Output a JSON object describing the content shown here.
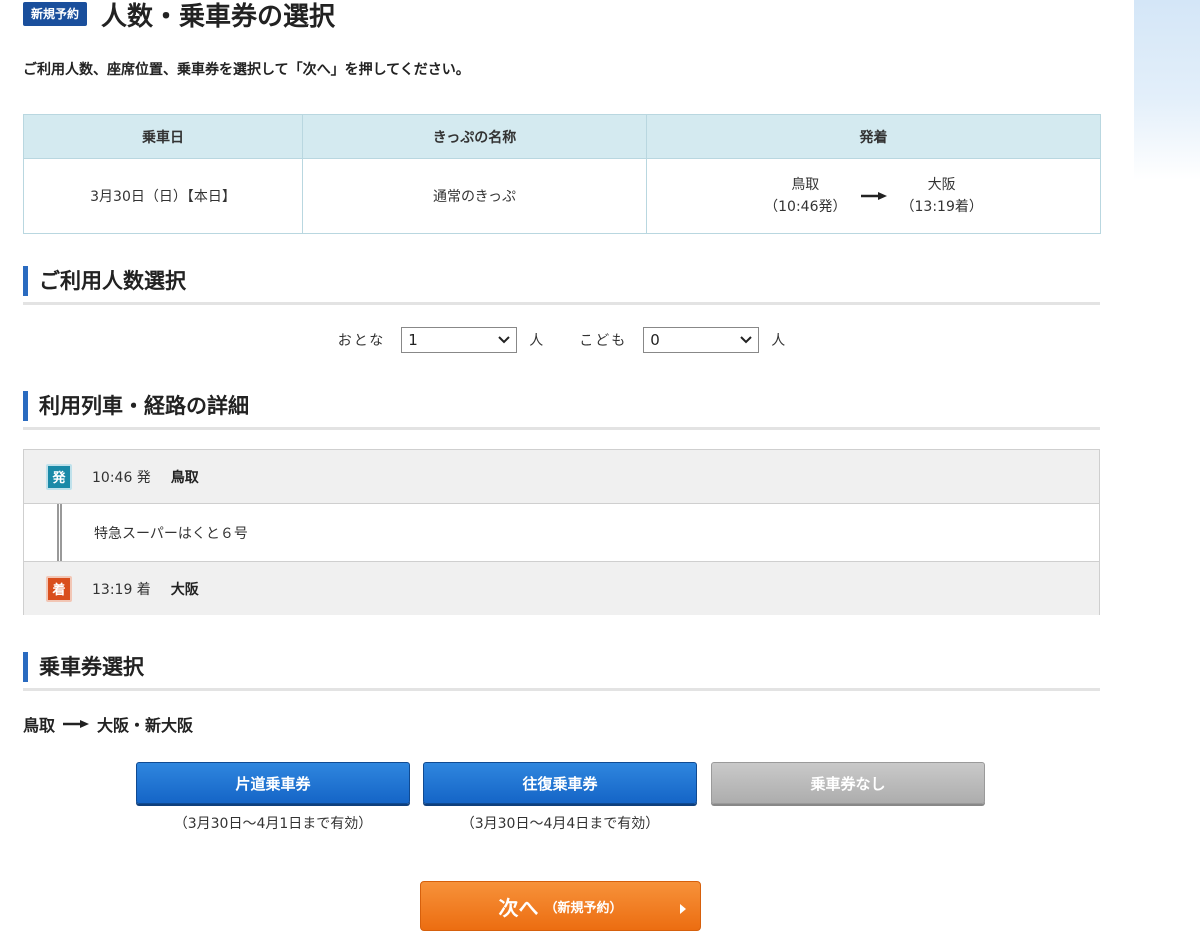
{
  "header": {
    "badge": "新規予約",
    "title": "人数・乗車券の選択",
    "instruction": "ご利用人数、座席位置、乗車券を選択して「次へ」を押してください。"
  },
  "summary": {
    "headers": [
      "乗車日",
      "きっぷの名称",
      "発着"
    ],
    "date": "3月30日（日）【本日】",
    "ticket_name": "通常のきっぷ",
    "from_station": "鳥取",
    "from_time": "（10:46発）",
    "to_station": "大阪",
    "to_time": "（13:19着）"
  },
  "passengers": {
    "heading": "ご利用人数選択",
    "adult_label": "おとな",
    "adult_value": "1",
    "child_label": "こども",
    "child_value": "0",
    "unit": "人"
  },
  "route": {
    "heading": "利用列車・経路の詳細",
    "dep_tag": "発",
    "dep_time": "10:46 発",
    "dep_station": "鳥取",
    "train": "特急スーパーはくと６号",
    "arr_tag": "着",
    "arr_time": "13:19 着",
    "arr_station": "大阪"
  },
  "tickets": {
    "heading": "乗車券選択",
    "from": "鳥取",
    "to": "大阪・新大阪",
    "options": [
      {
        "label": "片道乗車券",
        "validity": "（3月30日〜4月1日まで有効）"
      },
      {
        "label": "往復乗車券",
        "validity": "（3月30日〜4月4日まで有効）"
      },
      {
        "label": "乗車券なし",
        "validity": ""
      }
    ]
  },
  "next_button": {
    "label": "次へ",
    "sub_label": "（新規予約）"
  },
  "colors": {
    "accent_blue": "#1565c7",
    "next_orange": "#ec6d11",
    "table_header": "#d4eaf0",
    "dep_tag": "#1a8aa8",
    "arr_tag": "#d94f1e"
  }
}
